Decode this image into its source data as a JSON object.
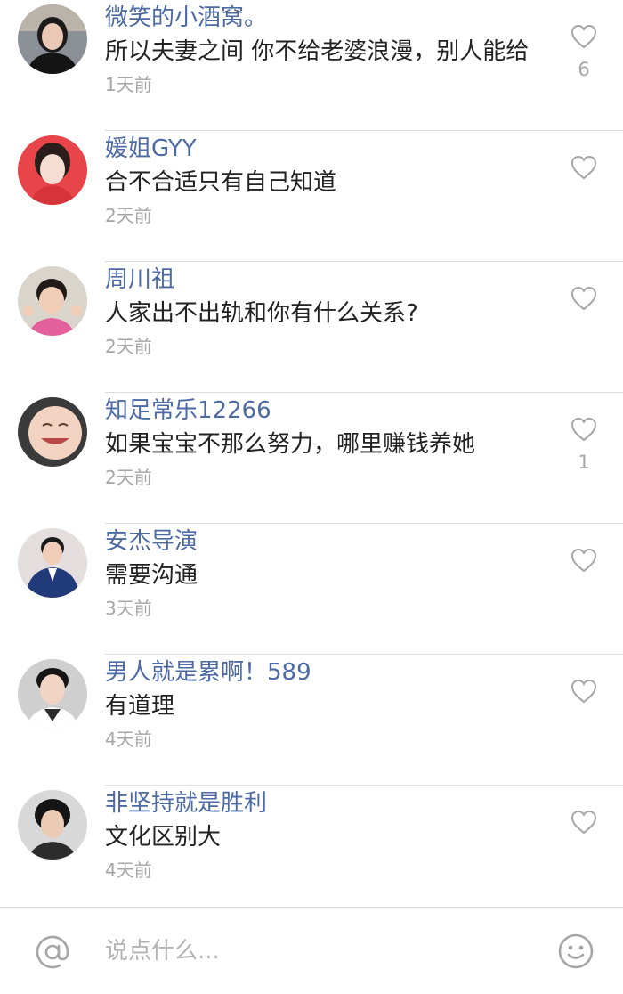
{
  "comments": [
    {
      "username": "微笑的小酒窝。",
      "text": "所以夫妻之间  你不给老婆浪漫，别人能给",
      "time": "1天前",
      "likes": "6",
      "avatar": "avatar-woman-dark-hair"
    },
    {
      "username": "媛姐GYY",
      "text": "合不合适只有自己知道",
      "time": "2天前",
      "likes": "",
      "avatar": "avatar-woman-red-background"
    },
    {
      "username": "周川祖",
      "text": "人家出不出轨和你有什么关系?",
      "time": "2天前",
      "likes": "",
      "avatar": "avatar-child"
    },
    {
      "username": "知足常乐12266",
      "text": "如果宝宝不那么努力，哪里赚钱养她",
      "time": "2天前",
      "likes": "1",
      "avatar": "avatar-laughing-baby"
    },
    {
      "username": "安杰导演",
      "text": "需要沟通",
      "time": "3天前",
      "likes": "",
      "avatar": "avatar-man-blue-suit"
    },
    {
      "username": "男人就是累啊！589",
      "text": "有道理",
      "time": "4天前",
      "likes": "",
      "avatar": "avatar-young-man"
    },
    {
      "username": "非坚持就是胜利",
      "text": "文化区别大",
      "time": "4天前",
      "likes": "",
      "avatar": "avatar-short-hair"
    }
  ],
  "input": {
    "placeholder": "说点什么..."
  },
  "icons": {
    "at": "at-icon",
    "emoji": "emoji-icon",
    "like": "heart-outline-icon"
  },
  "colors": {
    "username": "#4d6aa3",
    "text": "#222222",
    "meta": "#a6a6a6",
    "divider": "#dcdcdc"
  }
}
